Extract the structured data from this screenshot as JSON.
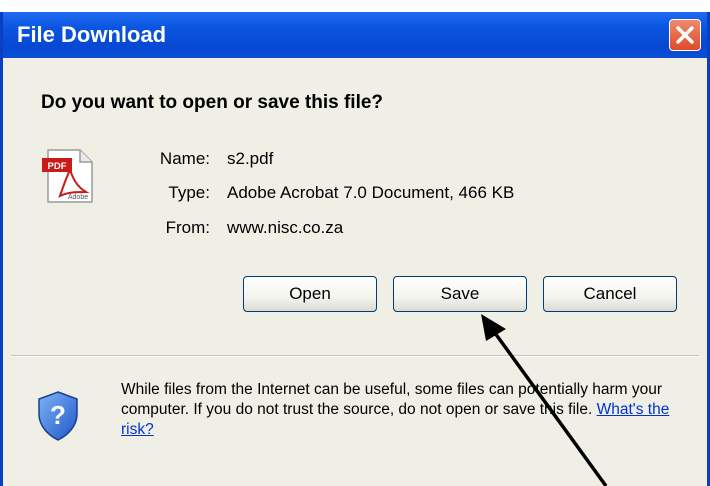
{
  "dialog": {
    "title": "File Download",
    "question": "Do you want to open or save this file?",
    "file_icon": "pdf-file-icon",
    "fields": {
      "name_label": "Name:",
      "name_value": "s2.pdf",
      "type_label": "Type:",
      "type_value": "Adobe Acrobat 7.0 Document, 466 KB",
      "from_label": "From:",
      "from_value": "www.nisc.co.za"
    },
    "buttons": {
      "open": "Open",
      "save": "Save",
      "cancel": "Cancel"
    },
    "warning": {
      "icon": "shield-question-icon",
      "text": "While files from the Internet can be useful, some files can potentially harm your computer. If you do not trust the source, do not open or save this file.",
      "link": "What's the risk?"
    }
  },
  "annotation": {
    "icon": "annotation-arrow-icon",
    "points_to": "Save"
  },
  "colors": {
    "titlebar": "#0b54e0",
    "dialog_bg": "#f0efe6",
    "close_button": "#dc4a2a",
    "button_border": "#003c74",
    "link": "#0033cc"
  }
}
